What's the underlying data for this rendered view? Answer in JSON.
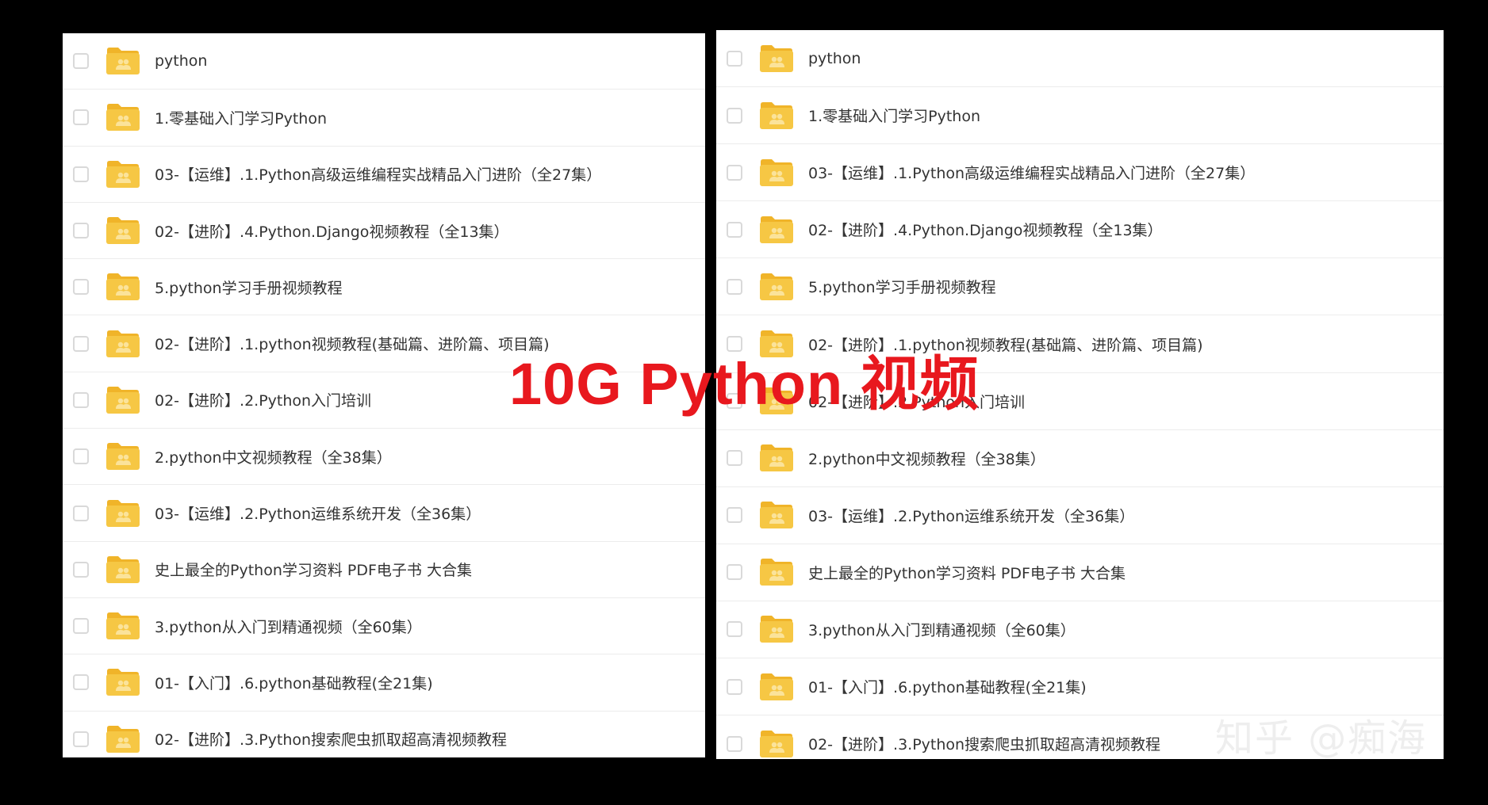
{
  "left_list": {
    "items": [
      {
        "label": "python"
      },
      {
        "label": "1.零基础入门学习Python"
      },
      {
        "label": "03-【运维】.1.Python高级运维编程实战精品入门进阶（全27集）"
      },
      {
        "label": "02-【进阶】.4.Python.Django视频教程（全13集）"
      },
      {
        "label": "5.python学习手册视频教程"
      },
      {
        "label": "02-【进阶】.1.python视频教程(基础篇、进阶篇、项目篇)"
      },
      {
        "label": "02-【进阶】.2.Python入门培训"
      },
      {
        "label": "2.python中文视频教程（全38集）"
      },
      {
        "label": "03-【运维】.2.Python运维系统开发（全36集）"
      },
      {
        "label": "史上最全的Python学习资料 PDF电子书 大合集"
      },
      {
        "label": "3.python从入门到精通视频（全60集）"
      },
      {
        "label": "01-【入门】.6.python基础教程(全21集)"
      },
      {
        "label": "02-【进阶】.3.Python搜索爬虫抓取超高清视频教程"
      }
    ]
  },
  "right_list": {
    "items": [
      {
        "label": "python"
      },
      {
        "label": "1.零基础入门学习Python"
      },
      {
        "label": "03-【运维】.1.Python高级运维编程实战精品入门进阶（全27集）"
      },
      {
        "label": "02-【进阶】.4.Python.Django视频教程（全13集）"
      },
      {
        "label": "5.python学习手册视频教程"
      },
      {
        "label": "02-【进阶】.1.python视频教程(基础篇、进阶篇、项目篇)"
      },
      {
        "label": "02-【进阶】.2.Python入门培训"
      },
      {
        "label": "2.python中文视频教程（全38集）"
      },
      {
        "label": "03-【运维】.2.Python运维系统开发（全36集）"
      },
      {
        "label": "史上最全的Python学习资料 PDF电子书 大合集"
      },
      {
        "label": "3.python从入门到精通视频（全60集）"
      },
      {
        "label": "01-【入门】.6.python基础教程(全21集)"
      },
      {
        "label": "02-【进阶】.3.Python搜索爬虫抓取超高清视频教程"
      }
    ]
  },
  "overlay": {
    "headline": "10G Python 视频",
    "credit": "知乎 @痴海"
  },
  "icons": {
    "row_icon": "shared-folder-icon",
    "checkbox": "checkbox-unchecked"
  },
  "colors": {
    "folder": "#f6c744",
    "folder_tab": "#f0b429",
    "headline": "#e8181e",
    "background": "#000000",
    "panel": "#ffffff"
  }
}
